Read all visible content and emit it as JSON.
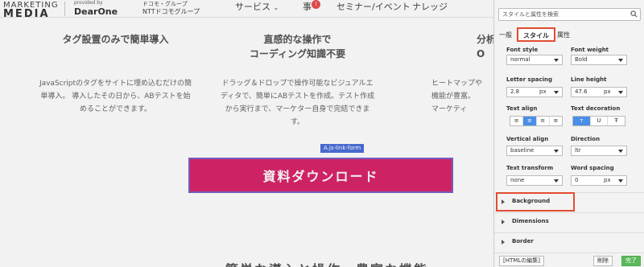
{
  "header": {
    "logo_top": "MARKETING",
    "logo_bottom": "MEDIA",
    "provided_by": "provided by",
    "brand": "DearOne",
    "group_top": "ドコモ・グループ",
    "group": "NTTドコモグループ",
    "nav": [
      "サービス",
      "事",
      "セミナー/イベント",
      "ナレッジ"
    ],
    "nav_badge": "!"
  },
  "features": [
    {
      "title": "タグ設置のみで簡単導入",
      "desc": "JavaScriptのタグをサイトに埋め込むだけの簡単導入。 導入したその日から、ABテストを始めることができます。"
    },
    {
      "title": "直感的な操作で\nコーディング知識不要",
      "desc": "ドラッグ＆ドロップで操作可能なビジュアルエディタで、簡単にABテストを作成。テスト作成から実行まで、マーケター自身で完結できます。"
    },
    {
      "title": "分析\nO",
      "desc": "ヒートマップや\n機能が豊富。\nマーケティ"
    }
  ],
  "element_tag": "A.js-link-form",
  "cta_label": "資料ダウンロード",
  "bottom_title": "簡単な導入と操作、豊富な機能",
  "panel": {
    "search_placeholder": "スタイルと属性を検索",
    "tabs": [
      "一般",
      "スタイル",
      "属性"
    ],
    "font_style": {
      "label": "Font style",
      "value": "normal"
    },
    "font_weight": {
      "label": "Font weight",
      "value": "Bold"
    },
    "letter_spacing": {
      "label": "Letter spacing",
      "value": "2.8",
      "unit": "px"
    },
    "line_height": {
      "label": "Line height",
      "value": "47.6",
      "unit": "px"
    },
    "text_align": {
      "label": "Text align",
      "options": [
        "≡",
        "≡",
        "≡",
        "≡"
      ]
    },
    "text_decoration": {
      "label": "Text decoration",
      "options": [
        "ᴛ",
        "U",
        "Ŧ"
      ]
    },
    "vertical_align": {
      "label": "Vertical align",
      "value": "baseline"
    },
    "direction": {
      "label": "Direction",
      "value": "ltr"
    },
    "text_transform": {
      "label": "Text transform",
      "value": "none"
    },
    "word_spacing": {
      "label": "Word spacing",
      "value": "0",
      "unit": "px"
    },
    "sections": [
      "Background",
      "Dimensions",
      "Border"
    ],
    "footer": {
      "html_edit": "[HTMLの編集]",
      "delete": "削除",
      "done": "完了"
    }
  },
  "colors": {
    "cta": "#d8256a",
    "highlight": "#e24c30",
    "active_toggle": "#4a8ee8",
    "done": "#5cb85c"
  }
}
